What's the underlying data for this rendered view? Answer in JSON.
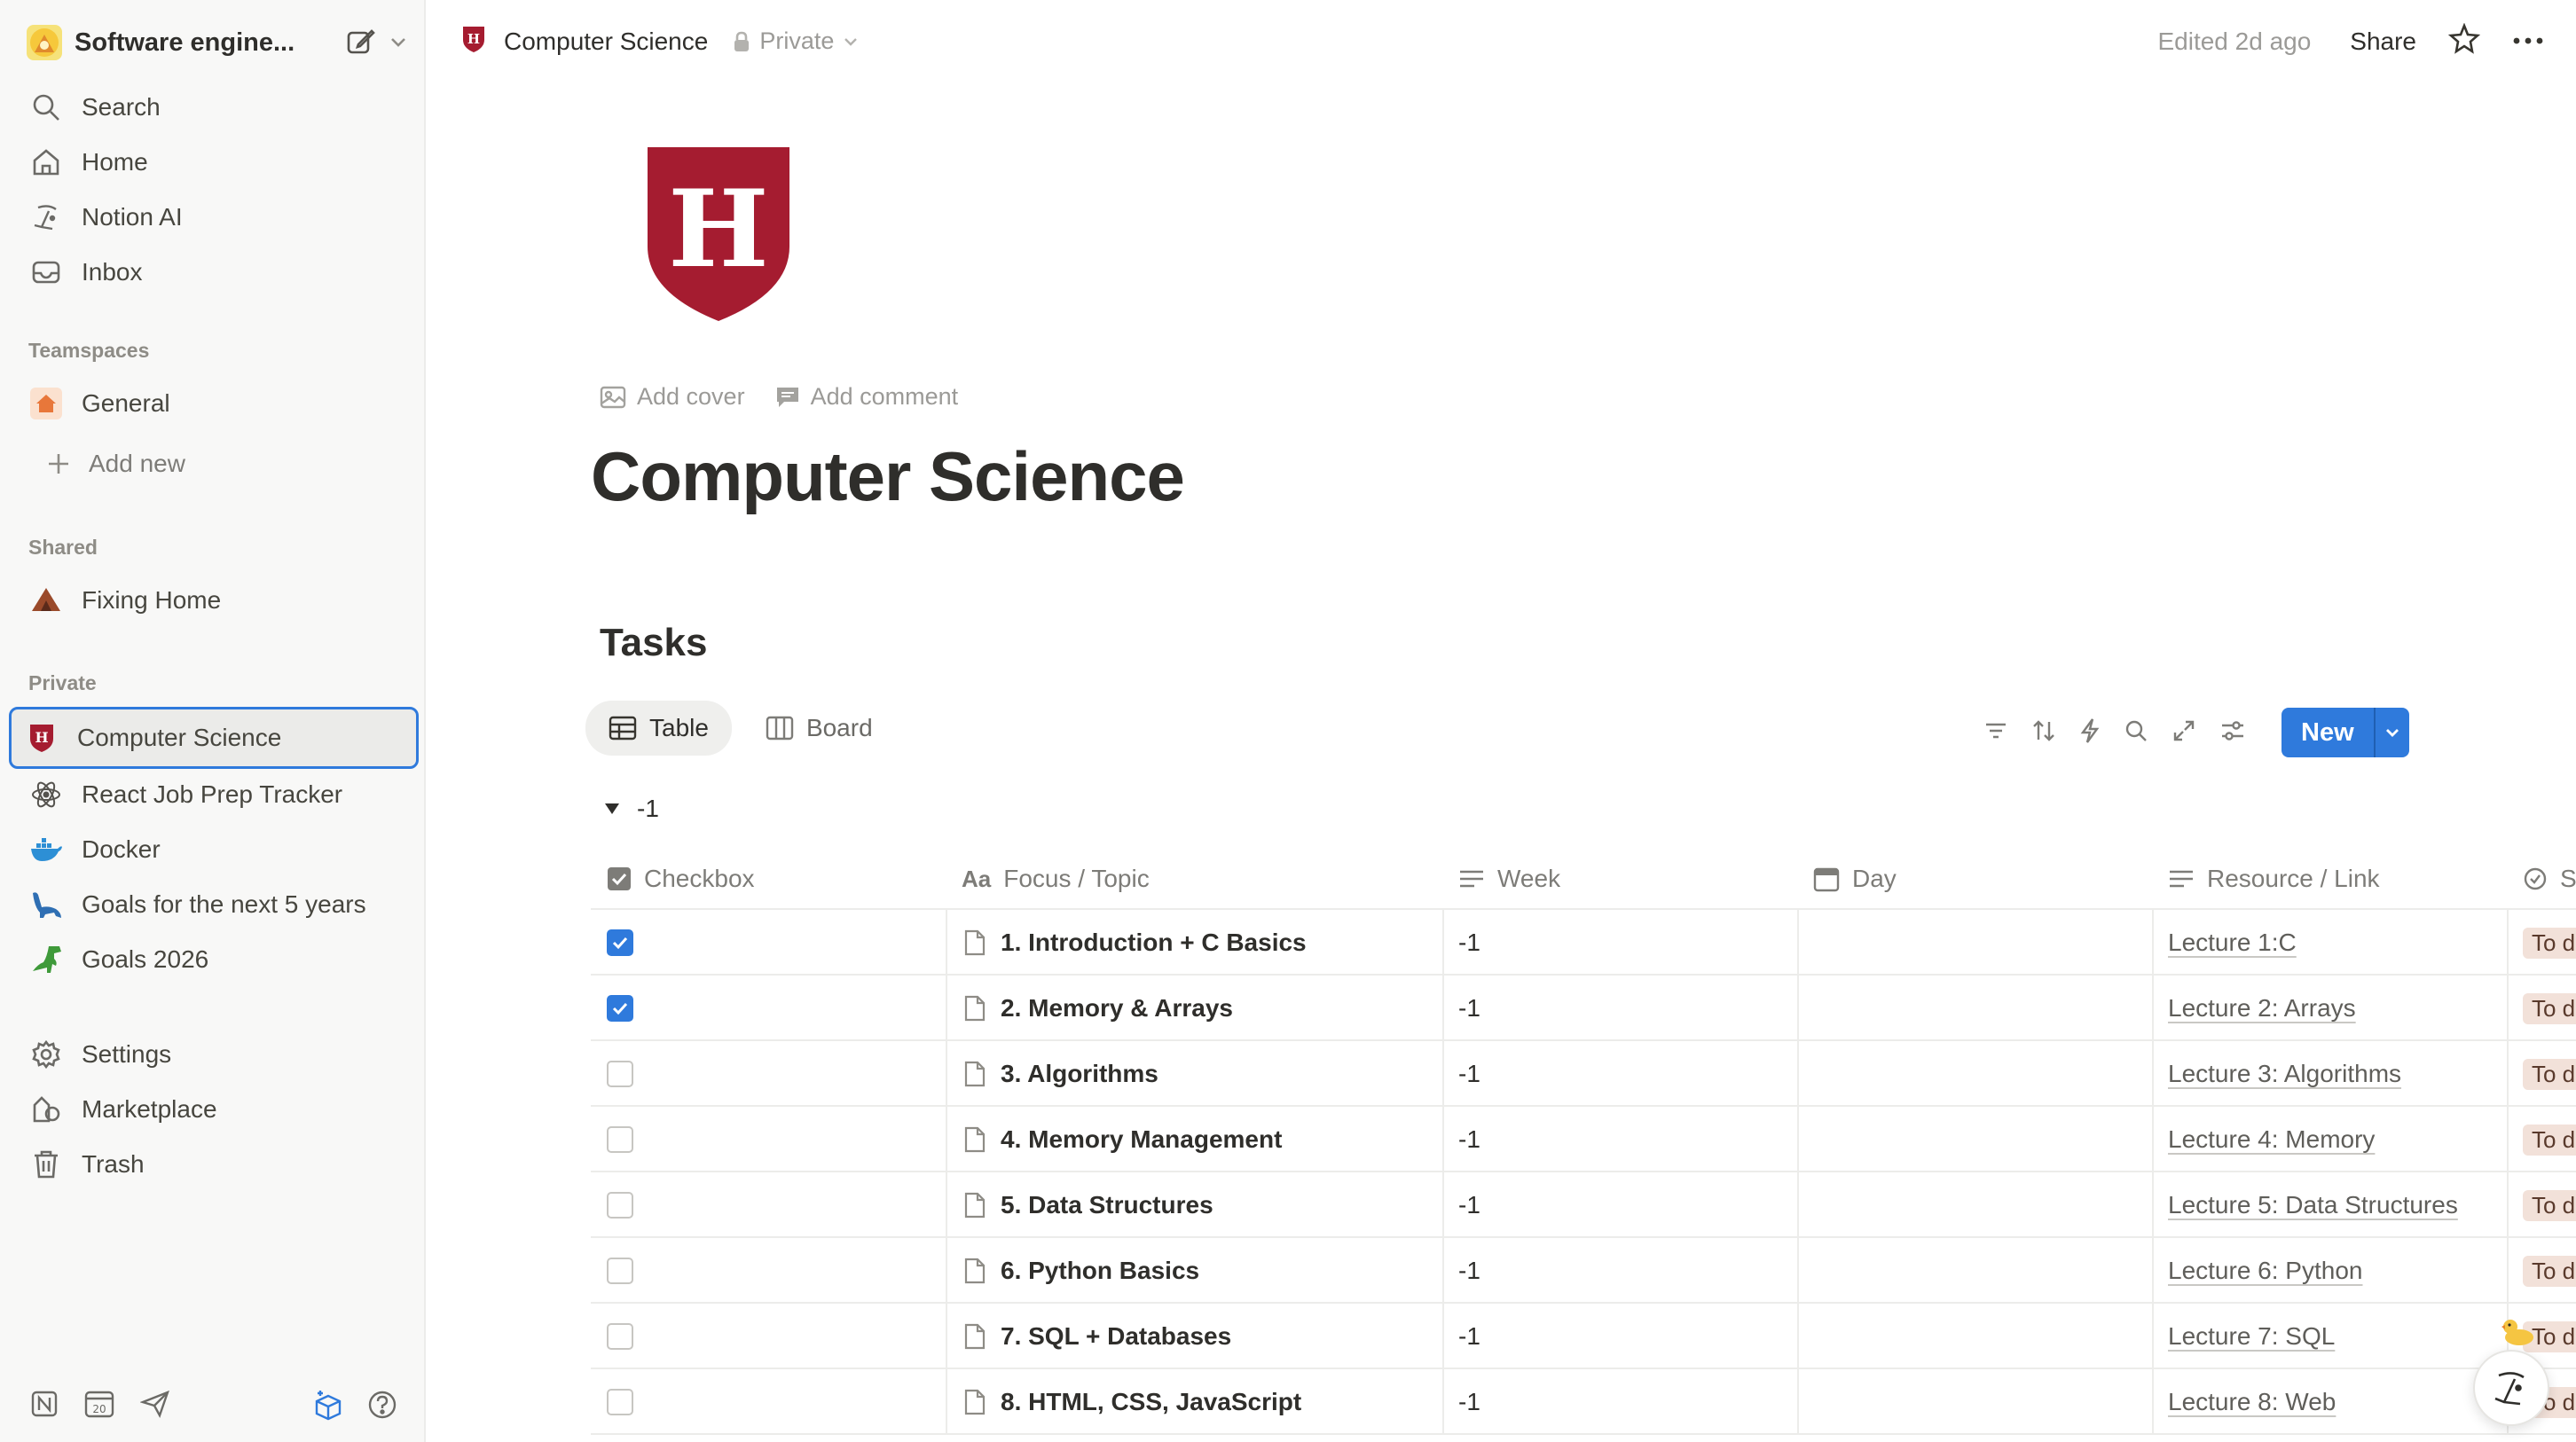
{
  "workspace": {
    "name": "Software engine...",
    "avatar_icon": "emoji-avatar-icon"
  },
  "sidebar": {
    "top_items": [
      {
        "label": "Search",
        "icon": "search-icon"
      },
      {
        "label": "Home",
        "icon": "home-icon"
      },
      {
        "label": "Notion AI",
        "icon": "ai-face-icon"
      },
      {
        "label": "Inbox",
        "icon": "inbox-icon"
      }
    ],
    "teamspaces_label": "Teamspaces",
    "teamspaces": [
      {
        "label": "General",
        "icon": "house-icon"
      }
    ],
    "add_new_label": "Add new",
    "shared_label": "Shared",
    "shared": [
      {
        "label": "Fixing Home",
        "icon": "hut-icon"
      }
    ],
    "private_label": "Private",
    "private": [
      {
        "label": "Computer Science",
        "icon": "shield-icon",
        "active": true
      },
      {
        "label": "React Job Prep Tracker",
        "icon": "atom-icon"
      },
      {
        "label": "Docker",
        "icon": "whale-icon"
      },
      {
        "label": "Goals for the next 5 years",
        "icon": "dinosaur-icon"
      },
      {
        "label": "Goals 2026",
        "icon": "t-rex-icon"
      }
    ],
    "bottom_items": [
      {
        "label": "Settings",
        "icon": "gear-icon"
      },
      {
        "label": "Marketplace",
        "icon": "marketplace-icon"
      },
      {
        "label": "Trash",
        "icon": "trash-icon"
      }
    ],
    "calendar_day": "20"
  },
  "topbar": {
    "page_title": "Computer Science",
    "privacy": "Private",
    "edited": "Edited 2d ago",
    "share": "Share"
  },
  "page": {
    "icon_letter": "H",
    "add_cover": "Add cover",
    "add_comment": "Add comment",
    "title": "Computer Science",
    "brand_color": "#a51c30"
  },
  "database": {
    "title": "Tasks",
    "views": [
      {
        "label": "Table",
        "icon": "table-icon"
      },
      {
        "label": "Board",
        "icon": "board-icon"
      }
    ],
    "new_label": "New",
    "group_label": "-1",
    "columns": [
      "Checkbox",
      "Focus / Topic",
      "Week",
      "Day",
      "Resource / Link",
      "S"
    ],
    "rows": [
      {
        "checked": true,
        "topic": "1. Introduction + C Basics",
        "week": "-1",
        "day": "",
        "resource": "Lecture 1:C",
        "status": "To d"
      },
      {
        "checked": true,
        "topic": "2. Memory & Arrays",
        "week": "-1",
        "day": "",
        "resource": "Lecture 2: Arrays",
        "status": "To d"
      },
      {
        "checked": false,
        "topic": "3. Algorithms",
        "week": "-1",
        "day": "",
        "resource": "Lecture 3: Algorithms",
        "status": "To d"
      },
      {
        "checked": false,
        "topic": "4. Memory Management",
        "week": "-1",
        "day": "",
        "resource": "Lecture 4: Memory",
        "status": "To d"
      },
      {
        "checked": false,
        "topic": "5. Data Structures",
        "week": "-1",
        "day": "",
        "resource": "Lecture 5: Data Structures",
        "status": "To d"
      },
      {
        "checked": false,
        "topic": "6. Python Basics",
        "week": "-1",
        "day": "",
        "resource": "Lecture 6: Python",
        "status": "To d"
      },
      {
        "checked": false,
        "topic": "7. SQL + Databases",
        "week": "-1",
        "day": "",
        "resource": "Lecture 7: SQL",
        "status": "To d"
      },
      {
        "checked": false,
        "topic": "8. HTML, CSS, JavaScript",
        "week": "-1",
        "day": "",
        "resource": "Lecture 8: Web",
        "status": "To d"
      }
    ]
  },
  "colors": {
    "accent": "#2f7adc",
    "status_bg": "#f2e1d9",
    "sidebar_bg": "#f8f8f7"
  }
}
